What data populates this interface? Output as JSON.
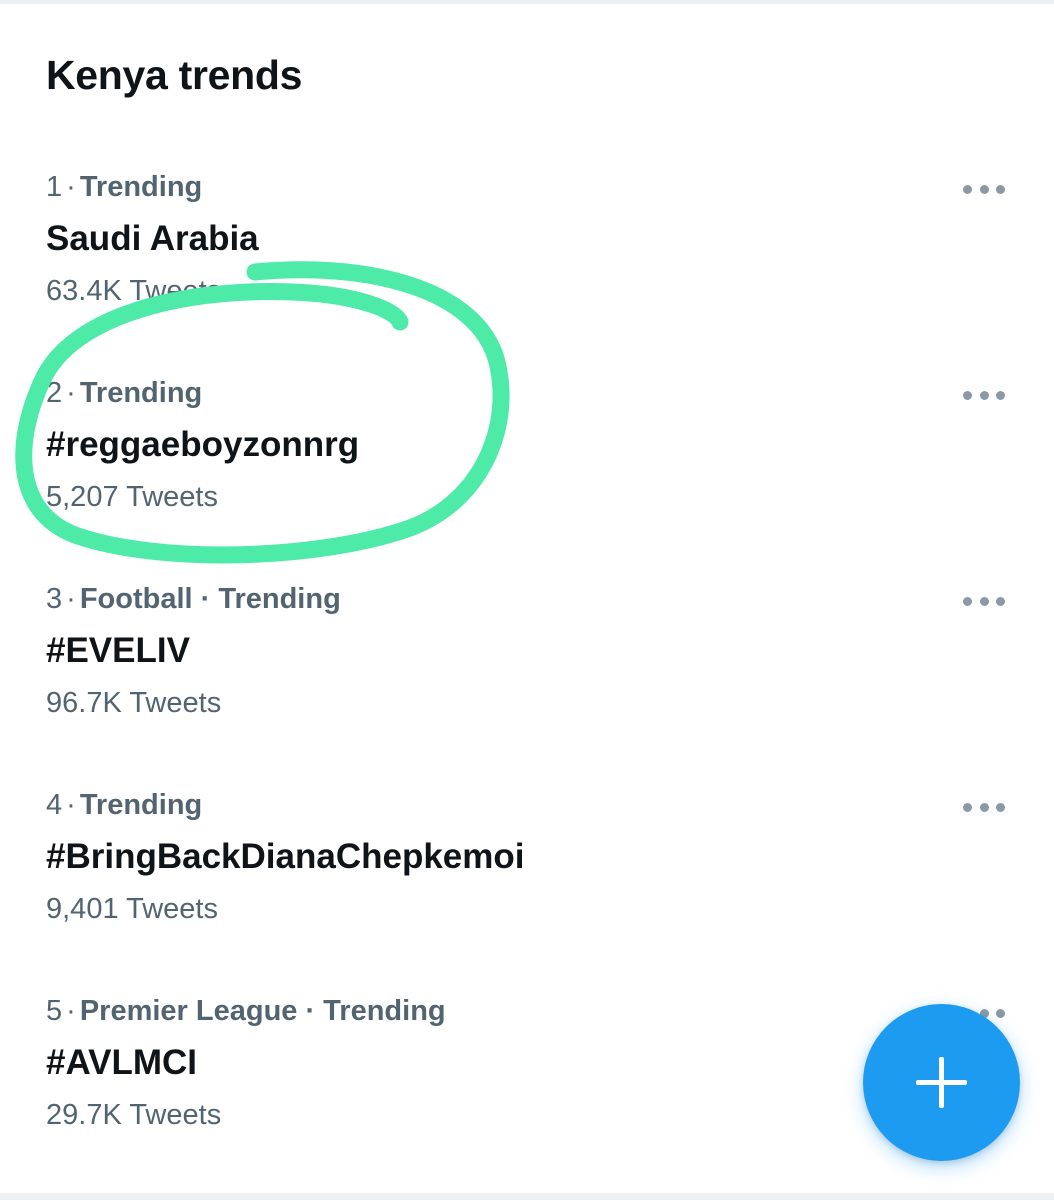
{
  "header": {
    "title": "Kenya trends"
  },
  "trends": [
    {
      "rank": "1",
      "context": "Trending",
      "name": "Saudi Arabia",
      "count": "63.4K Tweets"
    },
    {
      "rank": "2",
      "context": "Trending",
      "name": "#reggaeboyzonnrg",
      "count": "5,207 Tweets"
    },
    {
      "rank": "3",
      "context": "Football · Trending",
      "name": "#EVELIV",
      "count": "96.7K Tweets"
    },
    {
      "rank": "4",
      "context": "Trending",
      "name": "#BringBackDianaChepkemoi",
      "count": "9,401 Tweets"
    },
    {
      "rank": "5",
      "context": "Premier League · Trending",
      "name": "#AVLMCI",
      "count": "29.7K Tweets"
    }
  ],
  "icons": {
    "more": "more-horizontal-icon",
    "compose": "plus-icon"
  },
  "colors": {
    "accent": "#1d9bf0",
    "annotation": "#4eeaa8",
    "text_primary": "#0f1419",
    "text_secondary": "#536471"
  }
}
